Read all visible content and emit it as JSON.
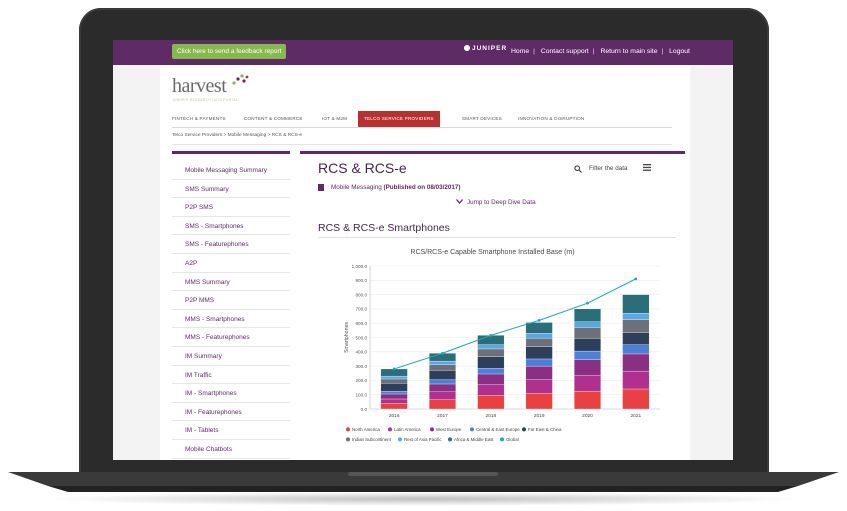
{
  "header": {
    "feedback_label": "Click here to send a feedback report",
    "brand": "JUNIPER",
    "links": [
      "Home",
      "Contact support",
      "Return to main site",
      "Logout"
    ]
  },
  "logo": {
    "text": "harvest",
    "tagline": "JUNIPER RESEARCH DATA PORTAL"
  },
  "nav": [
    {
      "label": "FINTECH & PAYMENTS",
      "active": false
    },
    {
      "label": "CONTENT & COMMERCE",
      "active": false
    },
    {
      "label": "IOT & M2M",
      "active": false
    },
    {
      "label": "TELCO SERVICE PROVIDERS",
      "active": true
    },
    {
      "label": "SMART DEVICES",
      "active": false
    },
    {
      "label": "INNOVATION & DISRUPTION",
      "active": false
    }
  ],
  "breadcrumb": "Telco Service Providers  >  Mobile Messaging  >  RCS & RCS-e",
  "sidebar": {
    "items": [
      "Mobile Messaging Summary",
      "SMS Summary",
      "P2P SMS",
      "SMS - Smartphones",
      "SMS - Featurephones",
      "A2P",
      "MMS Summary",
      "P2P MMS",
      "MMS - Smartphones",
      "MMS - Featurephones",
      "IM Summary",
      "IM Traffic",
      "IM - Smartphones",
      "IM - Featurephones",
      "IM - Tablets",
      "Mobile Chatbots"
    ]
  },
  "main": {
    "title": "RCS & RCS-e",
    "filter_label": "Filter the data",
    "doc_prefix": "Mobile Messaging ",
    "doc_published": "(Published on 08/03/2017)",
    "jump_label": "Jump to Deep Dive Data",
    "section_title": "RCS & RCS-e Smartphones"
  },
  "icons": {
    "search": "search-icon",
    "menu": "hamburger-menu-icon",
    "document": "document-icon",
    "chevron": "chevron-down-icon"
  },
  "colors": {
    "brand_purple": "#5f2b67",
    "accent_green": "#86b94b",
    "nav_active": "#b9312f"
  },
  "chart_data": {
    "type": "bar",
    "stacked": true,
    "title": "RCS/RCS-e Capable Smartphone Installed Base (m)",
    "ylabel": "Smartphones",
    "xlabel": "",
    "categories": [
      "2016",
      "2017",
      "2018",
      "2019",
      "2020",
      "2021"
    ],
    "ylim": [
      0,
      1000
    ],
    "yticks": [
      "0.0",
      "100.0",
      "200.0",
      "300.0",
      "400.0",
      "500.0",
      "600.0",
      "700.0",
      "800.0",
      "900.0",
      "1,000.0"
    ],
    "series": [
      {
        "name": "North America",
        "color": "#e8413f",
        "values": [
          40,
          65,
          95,
          110,
          125,
          140
        ]
      },
      {
        "name": "Latin America",
        "color": "#b0308f",
        "values": [
          30,
          55,
          75,
          95,
          110,
          125
        ]
      },
      {
        "name": "West Europe",
        "color": "#8a2f82",
        "values": [
          35,
          55,
          75,
          95,
          110,
          120
        ]
      },
      {
        "name": "Central & East Europe",
        "color": "#4b7fd8",
        "values": [
          20,
          30,
          40,
          50,
          60,
          65
        ]
      },
      {
        "name": "Far East & China",
        "color": "#2e3f5c",
        "values": [
          55,
          65,
          80,
          85,
          90,
          85
        ]
      },
      {
        "name": "Indian Subcontinent",
        "color": "#6e7077",
        "values": [
          30,
          40,
          55,
          60,
          75,
          90
        ]
      },
      {
        "name": "Rest of Asia Pacific",
        "color": "#5aa7e6",
        "values": [
          20,
          25,
          30,
          35,
          40,
          45
        ]
      },
      {
        "name": "Africa & Middle East",
        "color": "#2a6e7a",
        "values": [
          50,
          55,
          65,
          75,
          90,
          130
        ]
      }
    ],
    "line": {
      "name": "Global",
      "color": "#1ba8b8",
      "values": [
        280,
        390,
        515,
        620,
        740,
        910
      ]
    },
    "legend_position": "bottom",
    "grid": true
  }
}
